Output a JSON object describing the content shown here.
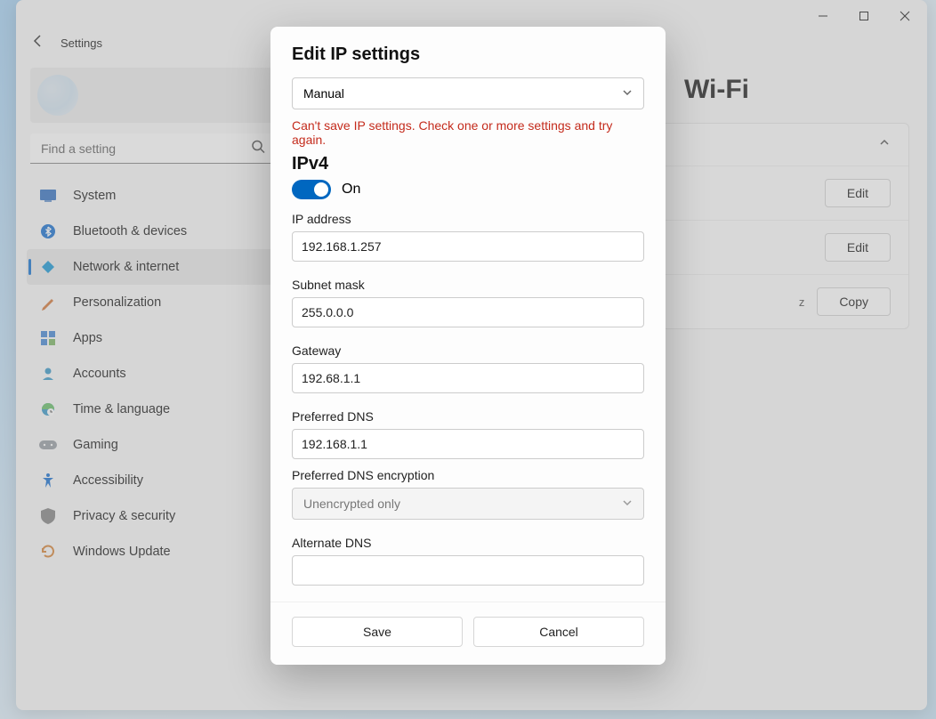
{
  "window": {
    "app_title": "Settings"
  },
  "search": {
    "placeholder": "Find a setting"
  },
  "sidebar": {
    "items": [
      {
        "label": "System"
      },
      {
        "label": "Bluetooth & devices"
      },
      {
        "label": "Network & internet"
      },
      {
        "label": "Personalization"
      },
      {
        "label": "Apps"
      },
      {
        "label": "Accounts"
      },
      {
        "label": "Time & language"
      },
      {
        "label": "Gaming"
      },
      {
        "label": "Accessibility"
      },
      {
        "label": "Privacy & security"
      },
      {
        "label": "Windows Update"
      }
    ]
  },
  "page": {
    "title_suffix": "Wi-Fi",
    "edit_button": "Edit",
    "copy_button": "Copy",
    "freq_suffix": "z"
  },
  "dialog": {
    "title": "Edit IP settings",
    "mode": "Manual",
    "error": "Can't save IP settings. Check one or more settings and try again.",
    "ipv4_heading": "IPv4",
    "toggle_label": "On",
    "fields": {
      "ip_label": "IP address",
      "ip_value": "192.168.1.257",
      "subnet_label": "Subnet mask",
      "subnet_value": "255.0.0.0",
      "gateway_label": "Gateway",
      "gateway_value": "192.68.1.1",
      "pdns_label": "Preferred DNS",
      "pdns_value": "192.168.1.1",
      "pdns_enc_label": "Preferred DNS encryption",
      "pdns_enc_value": "Unencrypted only",
      "adns_label": "Alternate DNS",
      "adns_value": ""
    },
    "save": "Save",
    "cancel": "Cancel"
  }
}
